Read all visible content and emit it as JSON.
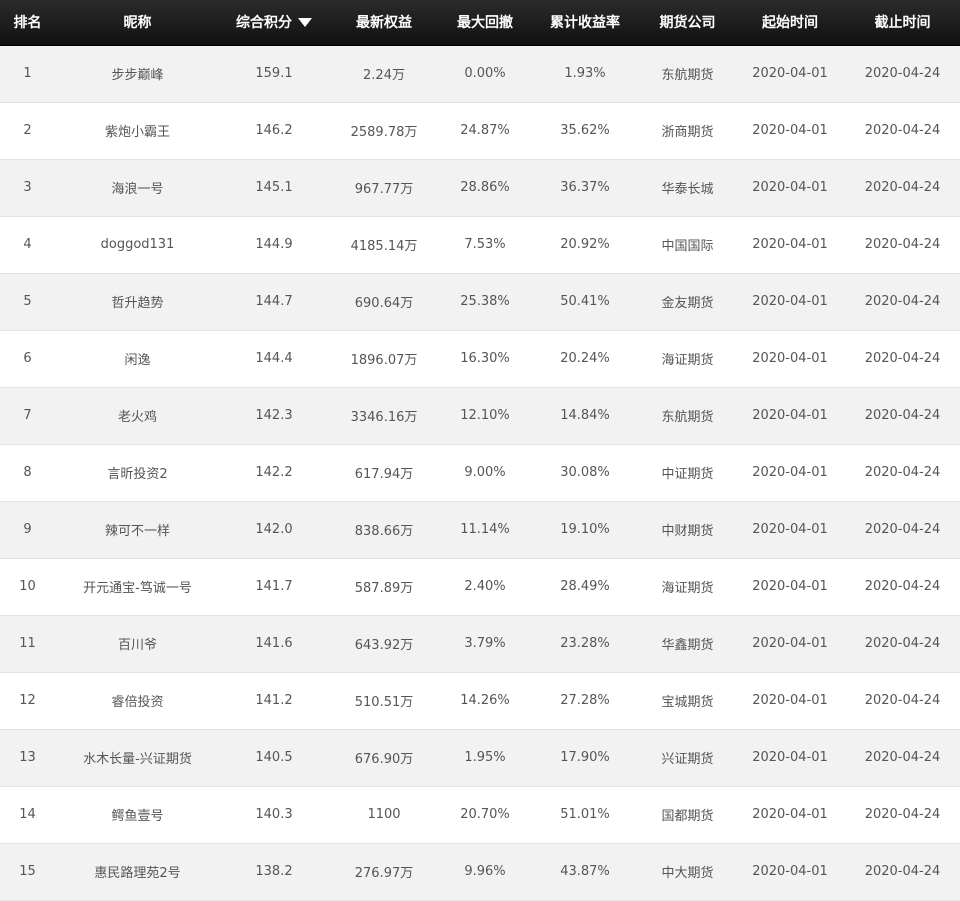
{
  "table": {
    "headers": [
      "排名",
      "昵称",
      "综合积分",
      "最新权益",
      "最大回撤",
      "累计收益率",
      "期货公司",
      "起始时间",
      "截止时间"
    ],
    "sort_icon": "caret-down-icon",
    "rows": [
      [
        "1",
        "步步巅峰",
        "159.1",
        "2.24万",
        "0.00%",
        "1.93%",
        "东航期货",
        "2020-04-01",
        "2020-04-24"
      ],
      [
        "2",
        "紫炮小霸王",
        "146.2",
        "2589.78万",
        "24.87%",
        "35.62%",
        "浙商期货",
        "2020-04-01",
        "2020-04-24"
      ],
      [
        "3",
        "海浪一号",
        "145.1",
        "967.77万",
        "28.86%",
        "36.37%",
        "华泰长城",
        "2020-04-01",
        "2020-04-24"
      ],
      [
        "4",
        "doggod131",
        "144.9",
        "4185.14万",
        "7.53%",
        "20.92%",
        "中国国际",
        "2020-04-01",
        "2020-04-24"
      ],
      [
        "5",
        "哲升趋势",
        "144.7",
        "690.64万",
        "25.38%",
        "50.41%",
        "金友期货",
        "2020-04-01",
        "2020-04-24"
      ],
      [
        "6",
        "闲逸",
        "144.4",
        "1896.07万",
        "16.30%",
        "20.24%",
        "海证期货",
        "2020-04-01",
        "2020-04-24"
      ],
      [
        "7",
        "老火鸡",
        "142.3",
        "3346.16万",
        "12.10%",
        "14.84%",
        "东航期货",
        "2020-04-01",
        "2020-04-24"
      ],
      [
        "8",
        "言昕投资2",
        "142.2",
        "617.94万",
        "9.00%",
        "30.08%",
        "中证期货",
        "2020-04-01",
        "2020-04-24"
      ],
      [
        "9",
        "辣可不一样",
        "142.0",
        "838.66万",
        "11.14%",
        "19.10%",
        "中财期货",
        "2020-04-01",
        "2020-04-24"
      ],
      [
        "10",
        "开元通宝-笃诚一号",
        "141.7",
        "587.89万",
        "2.40%",
        "28.49%",
        "海证期货",
        "2020-04-01",
        "2020-04-24"
      ],
      [
        "11",
        "百川爷",
        "141.6",
        "643.92万",
        "3.79%",
        "23.28%",
        "华鑫期货",
        "2020-04-01",
        "2020-04-24"
      ],
      [
        "12",
        "睿倍投资",
        "141.2",
        "510.51万",
        "14.26%",
        "27.28%",
        "宝城期货",
        "2020-04-01",
        "2020-04-24"
      ],
      [
        "13",
        "水木长量-兴证期货",
        "140.5",
        "676.90万",
        "1.95%",
        "17.90%",
        "兴证期货",
        "2020-04-01",
        "2020-04-24"
      ],
      [
        "14",
        "鳄鱼壹号",
        "140.3",
        "1100",
        "20.70%",
        "51.01%",
        "国都期货",
        "2020-04-01",
        "2020-04-24"
      ],
      [
        "15",
        "惠民路理苑2号",
        "138.2",
        "276.97万",
        "9.96%",
        "43.87%",
        "中大期货",
        "2020-04-01",
        "2020-04-24"
      ]
    ]
  }
}
